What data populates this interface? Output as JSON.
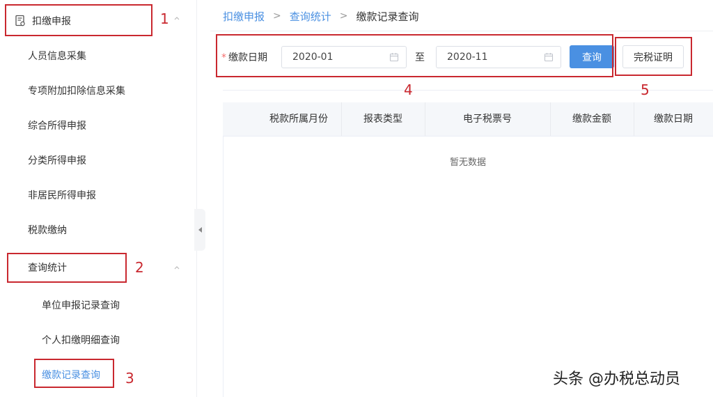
{
  "sidebar": {
    "header_label": "扣缴申报",
    "items": [
      {
        "label": "人员信息采集"
      },
      {
        "label": "专项附加扣除信息采集"
      },
      {
        "label": "综合所得申报"
      },
      {
        "label": "分类所得申报"
      },
      {
        "label": "非居民所得申报"
      },
      {
        "label": "税款缴纳"
      },
      {
        "label": "查询统计"
      }
    ],
    "sub_items": [
      {
        "label": "单位申报记录查询"
      },
      {
        "label": "个人扣缴明细查询"
      },
      {
        "label": "缴款记录查询"
      }
    ]
  },
  "breadcrumb": {
    "level1": "扣缴申报",
    "level2": "查询统计",
    "current": "缴款记录查询",
    "separator": ">"
  },
  "filter": {
    "required_mark": "*",
    "date_label": "缴款日期",
    "start_value": "2020-01",
    "to_label": "至",
    "end_value": "2020-11",
    "query_button": "查询",
    "cert_button": "完税证明"
  },
  "table": {
    "columns": [
      "税款所属月份",
      "报表类型",
      "电子税票号",
      "缴款金额",
      "缴款日期"
    ],
    "empty_text": "暂无数据"
  },
  "annotations": {
    "n1": "1",
    "n2": "2",
    "n3": "3",
    "n4": "4",
    "n5": "5"
  },
  "watermark": "头条 @办税总动员",
  "colors": {
    "accent": "#4a90e2",
    "annotation": "#c9282f",
    "required": "#f56c6c"
  }
}
